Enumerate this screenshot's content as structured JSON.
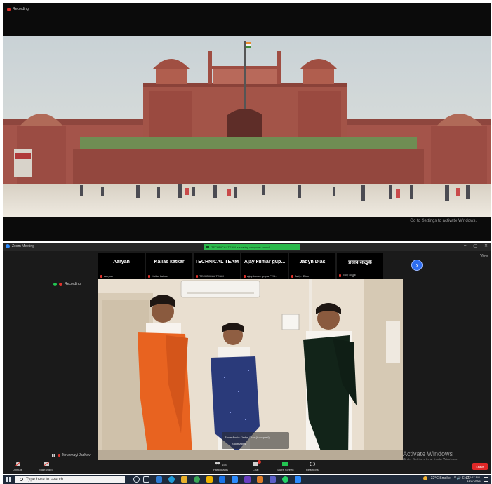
{
  "recording_top": {
    "label": "Recording"
  },
  "top_watermark": "Go to Settings to activate Windows.",
  "zoom": {
    "window_title": "Zoom Meeting",
    "share_banner": "TECHNICAL TEAM is sharing computer sound",
    "view_label": "View",
    "recording_label": "Recording",
    "participants": [
      {
        "name": "Aaryan",
        "small": "Aaryan"
      },
      {
        "name": "Kailas katkar",
        "small": "Kailas katkar"
      },
      {
        "name": "TECHNICAL TEAM",
        "small": "TECHNICAL TEAM"
      },
      {
        "name": "Ajay kumar gup...",
        "small": "Ajay kumar gupta FYB..."
      },
      {
        "name": "Jadyn Dias",
        "small": "Jadyn Dias"
      },
      {
        "name": "प्रसाद साळुंके",
        "small": "प्रसाद साळुंके"
      }
    ],
    "next_label": "›",
    "caption_line1": "Zoom Audio: Jadyn Dias (Accepted)",
    "caption_line2": "Zoom Apps",
    "self_name": "Mrunmayi Jadhav",
    "activate_title": "Activate Windows",
    "activate_sub": "Go to Settings to activate Windows.",
    "toolbar": {
      "unmute": "Unmute",
      "start_video": "Start Video",
      "participants": "Participants",
      "participant_count": "154",
      "chat": "Chat",
      "share": "Share Screen",
      "reactions": "Reactions",
      "leave": "Leave"
    },
    "window_controls": [
      "–",
      "▢",
      "✕"
    ]
  },
  "taskbar": {
    "search_placeholder": "Type here to search",
    "weather": "32°C Smoke",
    "tray_icons": "^ 🔊 ENG",
    "time": "12:57 PM",
    "date": "11/27/2021"
  }
}
